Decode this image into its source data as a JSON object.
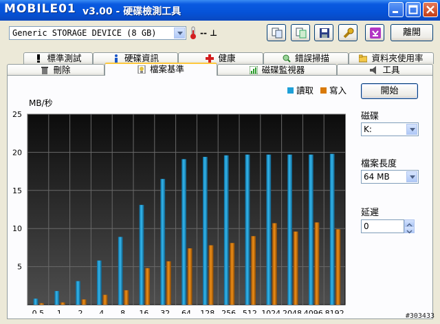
{
  "window": {
    "logo": "MOBILE01",
    "title": "v3.00 - 硬碟檢測工具"
  },
  "toolbar": {
    "device": "Generic STORAGE DEVICE (8 GB)",
    "temperature": "-- ⊥",
    "close_label": "離開"
  },
  "tabs_top": [
    {
      "label": "標準測試",
      "icon": "exclamation-icon"
    },
    {
      "label": "硬碟資訊",
      "icon": "info-icon"
    },
    {
      "label": "健康",
      "icon": "red-cross-icon"
    },
    {
      "label": "錯誤掃描",
      "icon": "magnifier-icon"
    },
    {
      "label": "資料夾使用率",
      "icon": "folder-icon"
    }
  ],
  "tabs_bottom": [
    {
      "label": "刪除",
      "icon": "trash-icon"
    },
    {
      "label": "檔案基準",
      "icon": "file-bench-icon",
      "active": true
    },
    {
      "label": "磁碟監視器",
      "icon": "monitor-chart-icon"
    },
    {
      "label": "工具",
      "icon": "speaker-icon"
    }
  ],
  "controls": {
    "start_label": "開始",
    "disk_label": "磁碟",
    "disk_value": "K:",
    "file_length_label": "檔案長度",
    "file_length_value": "64 MB",
    "delay_label": "延遲",
    "delay_value": "0"
  },
  "watermark": "#303433",
  "colors": {
    "read": "#1ea0d8",
    "write": "#d97a0a",
    "plot_bg_top": "#101010",
    "plot_bg_bottom": "#4a4a4a"
  },
  "chart_data": {
    "type": "bar",
    "ylabel": "MB/秒",
    "ylim": [
      0,
      25
    ],
    "yticks": [
      5,
      10,
      15,
      20,
      25
    ],
    "grid": true,
    "legend_position": "top-right",
    "categories": [
      "0.5",
      "1",
      "2",
      "4",
      "8",
      "16",
      "32",
      "64",
      "128",
      "256",
      "512",
      "1024",
      "2048",
      "4096",
      "8192"
    ],
    "series": [
      {
        "name": "讀取",
        "values": [
          0.8,
          1.8,
          3.1,
          5.8,
          8.9,
          13.1,
          16.5,
          19.1,
          19.4,
          19.6,
          19.7,
          19.7,
          19.7,
          19.7,
          19.8
        ]
      },
      {
        "name": "寫入",
        "values": [
          0.2,
          0.3,
          0.7,
          1.3,
          1.9,
          4.8,
          5.7,
          7.4,
          7.8,
          8.1,
          9.0,
          10.7,
          9.6,
          10.8,
          9.9
        ]
      }
    ]
  }
}
